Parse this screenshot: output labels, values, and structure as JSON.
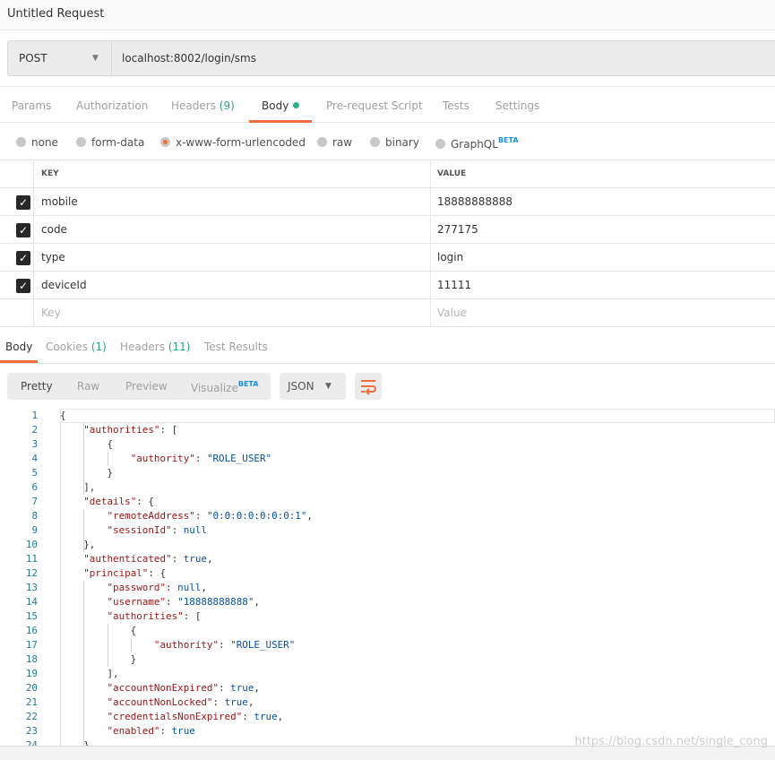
{
  "title": "Untitled Request",
  "request": {
    "method": "POST",
    "url": "localhost:8002/login/sms"
  },
  "req_tabs": [
    {
      "label": "Params"
    },
    {
      "label": "Authorization"
    },
    {
      "label": "Headers",
      "count": "(9)"
    },
    {
      "label": "Body",
      "active": true
    },
    {
      "label": "Pre-request Script"
    },
    {
      "label": "Tests"
    },
    {
      "label": "Settings"
    }
  ],
  "body_types": [
    {
      "label": "none"
    },
    {
      "label": "form-data"
    },
    {
      "label": "x-www-form-urlencoded",
      "selected": true
    },
    {
      "label": "raw"
    },
    {
      "label": "binary"
    },
    {
      "label": "GraphQL",
      "badge": "BETA"
    }
  ],
  "kv": {
    "key_header": "KEY",
    "value_header": "VALUE",
    "rows": [
      {
        "key": "mobile",
        "value": "18888888888",
        "checked": true
      },
      {
        "key": "code",
        "value": "277175",
        "checked": true
      },
      {
        "key": "type",
        "value": "login",
        "checked": true
      },
      {
        "key": "deviceId",
        "value": "11111",
        "checked": true
      }
    ],
    "key_placeholder": "Key",
    "value_placeholder": "Value"
  },
  "res_tabs": [
    {
      "label": "Body",
      "active": true
    },
    {
      "label": "Cookies",
      "count": "(1)"
    },
    {
      "label": "Headers",
      "count": "(11)"
    },
    {
      "label": "Test Results"
    }
  ],
  "view_modes": [
    {
      "label": "Pretty",
      "active": true
    },
    {
      "label": "Raw"
    },
    {
      "label": "Preview"
    },
    {
      "label": "Visualize",
      "badge": "BETA"
    }
  ],
  "format": "JSON",
  "wrap_icon": "wrap-lines-icon",
  "colors": {
    "accent": "#f26b3a",
    "count": "#26a676",
    "key": "#a31515",
    "value": "#0451a5"
  },
  "code": [
    [
      [
        "p",
        "{"
      ]
    ],
    [
      [
        "p",
        "    "
      ],
      [
        "k",
        "\"authorities\""
      ],
      [
        "p",
        ": ["
      ]
    ],
    [
      [
        "p",
        "        {"
      ]
    ],
    [
      [
        "p",
        "            "
      ],
      [
        "k",
        "\"authority\""
      ],
      [
        "p",
        ": "
      ],
      [
        "s",
        "\"ROLE_USER\""
      ]
    ],
    [
      [
        "p",
        "        }"
      ]
    ],
    [
      [
        "p",
        "    ],"
      ]
    ],
    [
      [
        "p",
        "    "
      ],
      [
        "k",
        "\"details\""
      ],
      [
        "p",
        ": {"
      ]
    ],
    [
      [
        "p",
        "        "
      ],
      [
        "k",
        "\"remoteAddress\""
      ],
      [
        "p",
        ": "
      ],
      [
        "s",
        "\"0:0:0:0:0:0:0:1\""
      ],
      [
        "p",
        ","
      ]
    ],
    [
      [
        "p",
        "        "
      ],
      [
        "k",
        "\"sessionId\""
      ],
      [
        "p",
        ": "
      ],
      [
        "v",
        "null"
      ]
    ],
    [
      [
        "p",
        "    },"
      ]
    ],
    [
      [
        "p",
        "    "
      ],
      [
        "k",
        "\"authenticated\""
      ],
      [
        "p",
        ": "
      ],
      [
        "v",
        "true"
      ],
      [
        "p",
        ","
      ]
    ],
    [
      [
        "p",
        "    "
      ],
      [
        "k",
        "\"principal\""
      ],
      [
        "p",
        ": {"
      ]
    ],
    [
      [
        "p",
        "        "
      ],
      [
        "k",
        "\"password\""
      ],
      [
        "p",
        ": "
      ],
      [
        "v",
        "null"
      ],
      [
        "p",
        ","
      ]
    ],
    [
      [
        "p",
        "        "
      ],
      [
        "k",
        "\"username\""
      ],
      [
        "p",
        ": "
      ],
      [
        "s",
        "\"18888888888\""
      ],
      [
        "p",
        ","
      ]
    ],
    [
      [
        "p",
        "        "
      ],
      [
        "k",
        "\"authorities\""
      ],
      [
        "p",
        ": ["
      ]
    ],
    [
      [
        "p",
        "            {"
      ]
    ],
    [
      [
        "p",
        "                "
      ],
      [
        "k",
        "\"authority\""
      ],
      [
        "p",
        ": "
      ],
      [
        "s",
        "\"ROLE_USER\""
      ]
    ],
    [
      [
        "p",
        "            }"
      ]
    ],
    [
      [
        "p",
        "        ],"
      ]
    ],
    [
      [
        "p",
        "        "
      ],
      [
        "k",
        "\"accountNonExpired\""
      ],
      [
        "p",
        ": "
      ],
      [
        "v",
        "true"
      ],
      [
        "p",
        ","
      ]
    ],
    [
      [
        "p",
        "        "
      ],
      [
        "k",
        "\"accountNonLocked\""
      ],
      [
        "p",
        ": "
      ],
      [
        "v",
        "true"
      ],
      [
        "p",
        ","
      ]
    ],
    [
      [
        "p",
        "        "
      ],
      [
        "k",
        "\"credentialsNonExpired\""
      ],
      [
        "p",
        ": "
      ],
      [
        "v",
        "true"
      ],
      [
        "p",
        ","
      ]
    ],
    [
      [
        "p",
        "        "
      ],
      [
        "k",
        "\"enabled\""
      ],
      [
        "p",
        ": "
      ],
      [
        "v",
        "true"
      ]
    ],
    [
      [
        "p",
        "    }"
      ]
    ]
  ],
  "watermark": "https://blog.csdn.net/single_cong"
}
